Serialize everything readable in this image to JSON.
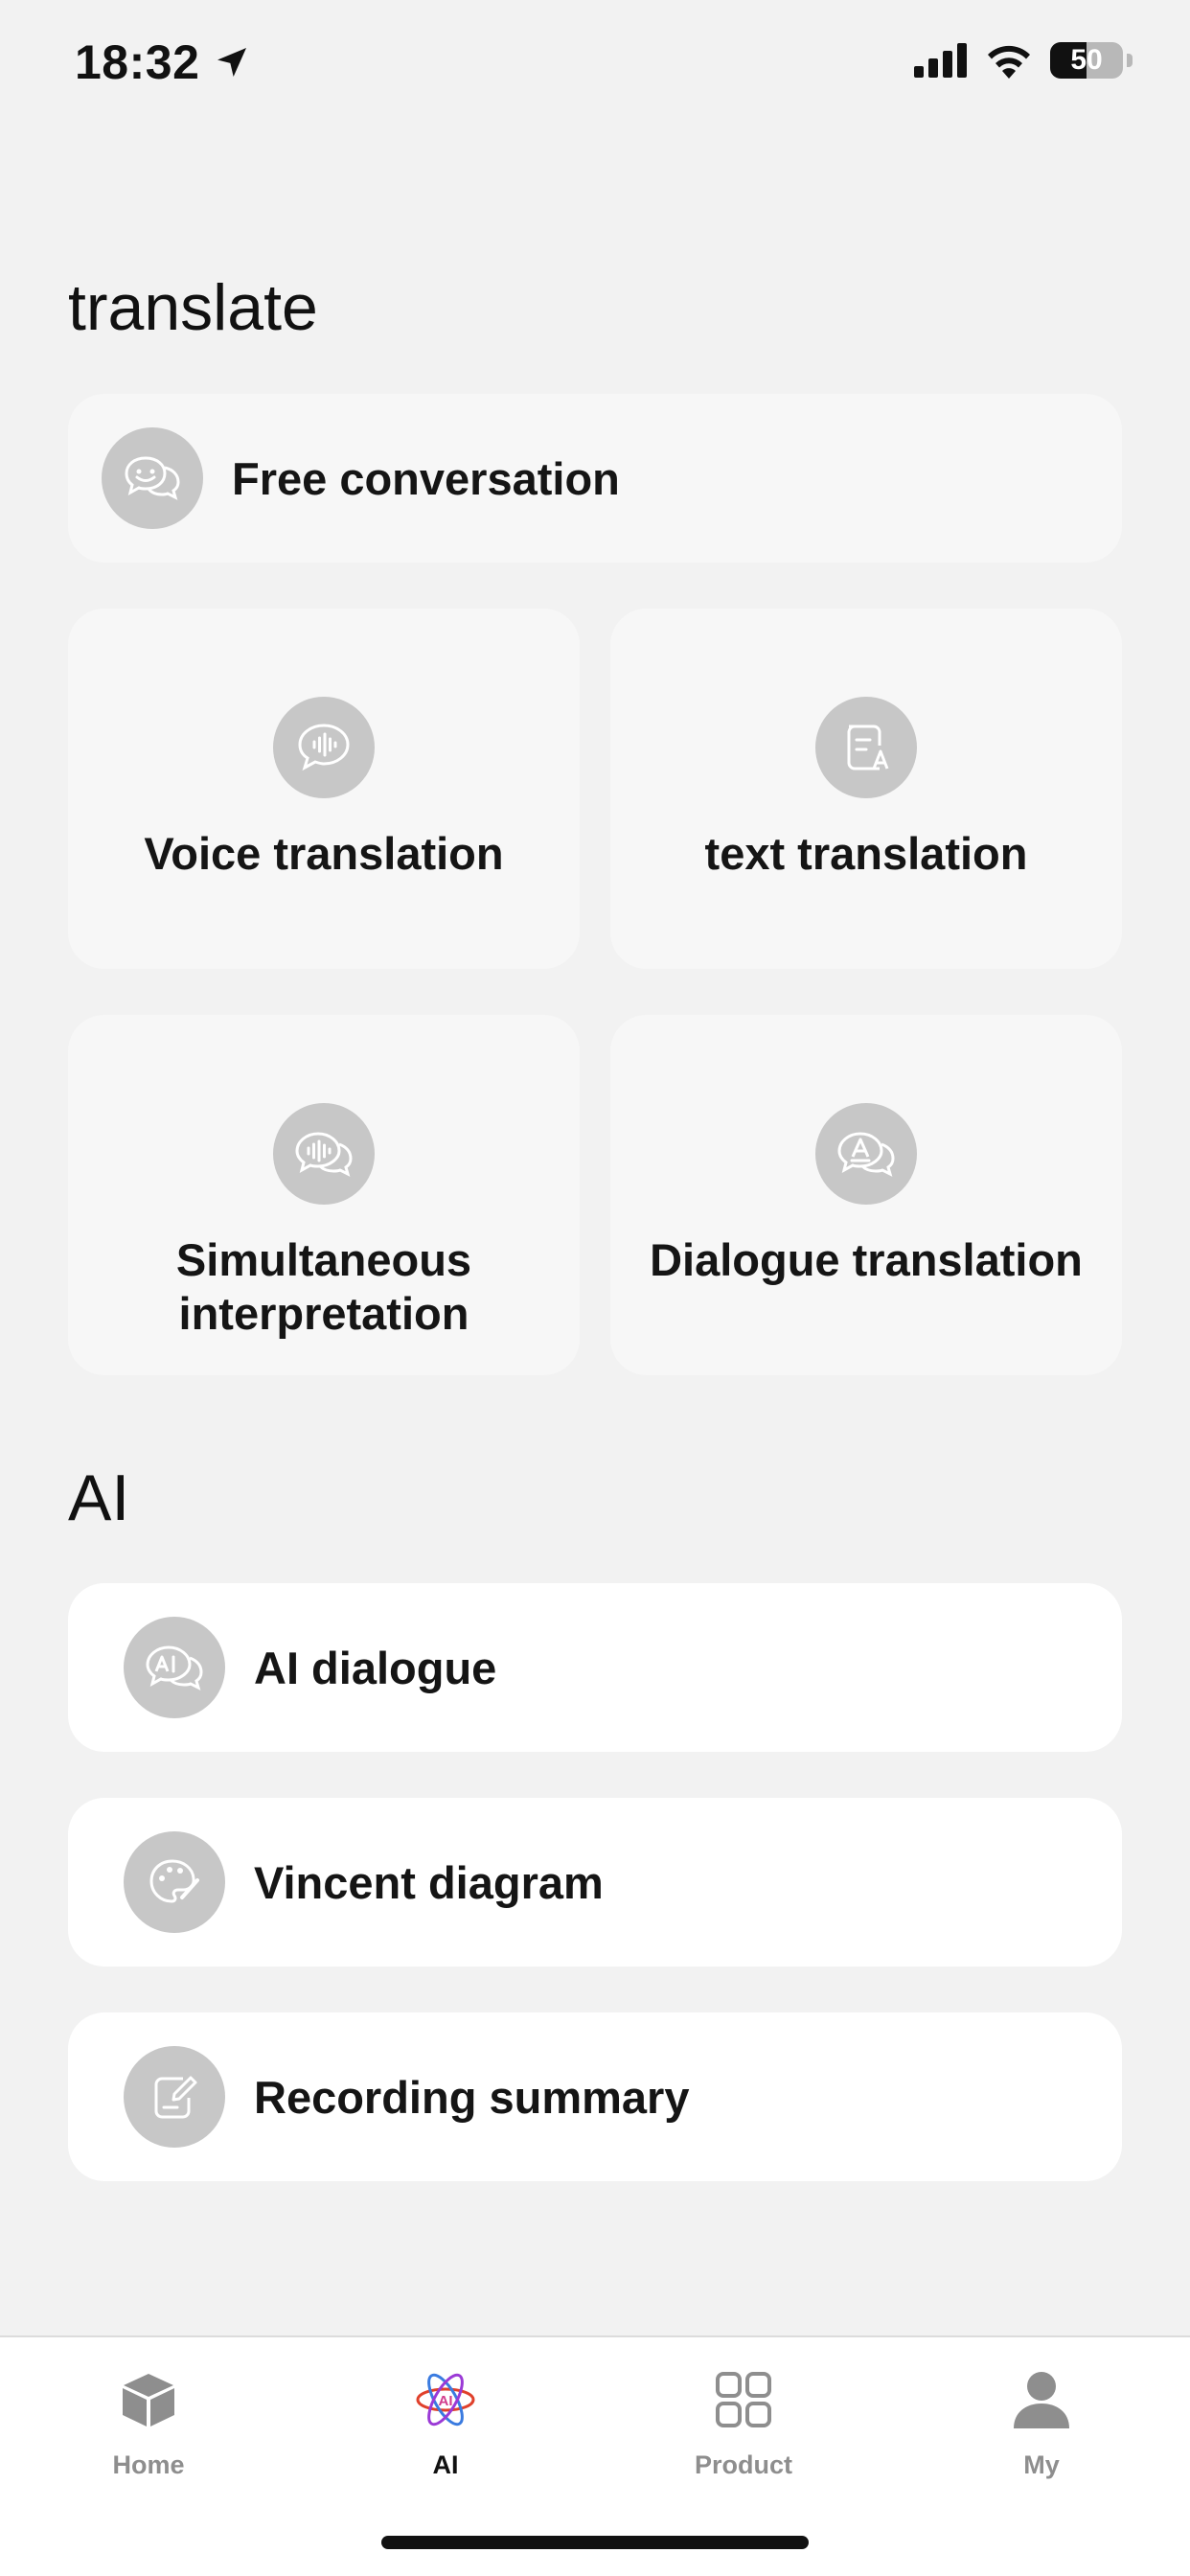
{
  "status_bar": {
    "time": "18:32",
    "battery": "50",
    "battery_level": 0.5,
    "icons": [
      "location-arrow-icon",
      "signal-icon",
      "wifi-icon",
      "battery-icon"
    ]
  },
  "sections": {
    "translate_title": "translate",
    "ai_title": "AI"
  },
  "translate": {
    "free_conversation": "Free conversation",
    "voice_translation": "Voice translation",
    "text_translation": "text translation",
    "simultaneous_interpretation": "Simultaneous interpretation",
    "dialogue_translation": "Dialogue translation"
  },
  "ai": {
    "ai_dialogue": "AI dialogue",
    "vincent_diagram": "Vincent diagram",
    "recording_summary": "Recording summary"
  },
  "tab_bar": {
    "home": "Home",
    "ai": "AI",
    "product": "Product",
    "my": "My",
    "active": "AI"
  },
  "colors": {
    "background": "#f2f2f2",
    "card": "#f7f7f7",
    "card_white": "#ffffff",
    "icon_circle": "#c7c7c7",
    "tab_inactive": "#8e8e8e"
  }
}
